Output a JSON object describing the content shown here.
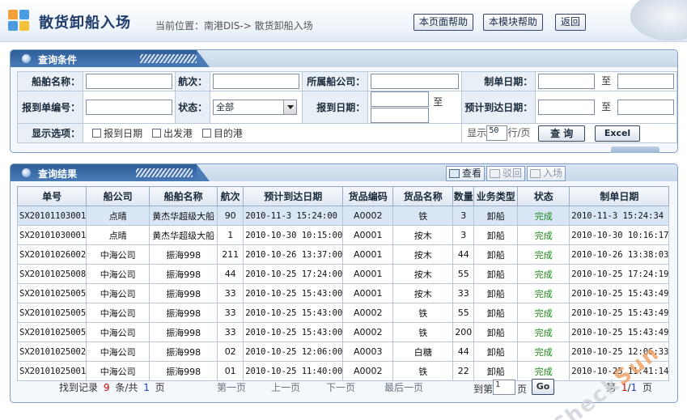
{
  "header": {
    "title": "散货卸船入场",
    "crumb_label": "当前位置：",
    "crumb_path": "南港DIS-> 散货卸船入场",
    "btn_page_help": "本页面帮助",
    "btn_module_help": "本模块帮助",
    "btn_back": "返回"
  },
  "query": {
    "title": "查询条件",
    "ship_name_label": "船舶名称：",
    "voyage_label": "航次：",
    "company_label": "所属船公司：",
    "created_date_label": "制单日期：",
    "to1": "至",
    "report_no_label": "报到单编号：",
    "status_label": "状态：",
    "status_value": "全部",
    "report_date_label": "报到日期：",
    "to2": "至",
    "eta_label": "预计到达日期：",
    "to3": "至",
    "display_label": "显示选项：",
    "opt_report_date": "报到日期",
    "opt_departure": "出发港",
    "opt_destination": "目的港",
    "show_prefix": "显示",
    "page_size": "50",
    "show_suffix": "行/页",
    "search_btn": "查 询",
    "excel_btn": "Excel"
  },
  "results": {
    "title": "查询结果",
    "tool_view": "查看",
    "tool_reject": "驳回",
    "tool_enter": "入场",
    "columns": [
      "单号",
      "船公司",
      "船舶名称",
      "航次",
      "预计到达日期",
      "货品编码",
      "货品名称",
      "数量",
      "业务类型",
      "状态",
      "制单日期"
    ],
    "rows": [
      [
        "SX20101103001",
        "点晴",
        "黄杰华超级大船",
        "90",
        "2010-11-3 15:24:00",
        "A0002",
        "铁",
        "3",
        "卸船",
        "完成",
        "2010-11-3 15:24:34"
      ],
      [
        "SX20101030001",
        "点晴",
        "黄杰华超级大船",
        "1",
        "2010-10-30 10:15:00",
        "A0001",
        "按木",
        "3",
        "卸船",
        "完成",
        "2010-10-30 10:16:17"
      ],
      [
        "SX20101026002",
        "中海公司",
        "振海998",
        "211",
        "2010-10-26 13:37:00",
        "A0001",
        "按木",
        "44",
        "卸船",
        "完成",
        "2010-10-26 13:38:03"
      ],
      [
        "SX20101025008",
        "中海公司",
        "振海998",
        "44",
        "2010-10-25 17:24:00",
        "A0001",
        "按木",
        "55",
        "卸船",
        "完成",
        "2010-10-25 17:24:19"
      ],
      [
        "SX20101025005",
        "中海公司",
        "振海998",
        "33",
        "2010-10-25 15:43:00",
        "A0001",
        "按木",
        "33",
        "卸船",
        "完成",
        "2010-10-25 15:43:49"
      ],
      [
        "SX20101025005",
        "中海公司",
        "振海998",
        "33",
        "2010-10-25 15:43:00",
        "A0002",
        "铁",
        "55",
        "卸船",
        "完成",
        "2010-10-25 15:43:49"
      ],
      [
        "SX20101025005",
        "中海公司",
        "振海998",
        "33",
        "2010-10-25 15:43:00",
        "A0002",
        "铁",
        "200",
        "卸船",
        "完成",
        "2010-10-25 15:43:49"
      ],
      [
        "SX20101025002",
        "中海公司",
        "振海998",
        "02",
        "2010-10-25 12:06:00",
        "A0003",
        "白糖",
        "44",
        "卸船",
        "完成",
        "2010-10-25 12:06:33"
      ],
      [
        "SX20101025001",
        "中海公司",
        "振海998",
        "01",
        "2010-10-25 11:40:00",
        "A0002",
        "铁",
        "22",
        "卸船",
        "完成",
        "2010-10-25 11:41:14"
      ]
    ],
    "pager": {
      "found_prefix": "找到记录",
      "total_records": "9",
      "found_mid": "条/共",
      "total_pages": "1",
      "found_suffix": "页",
      "first": "第一页",
      "prev": "上一页",
      "next": "下一页",
      "last": "最后一页",
      "goto_prefix": "到第",
      "goto_value": "1",
      "goto_suffix": "页",
      "go_btn": "Go",
      "page_prefix": "第",
      "current_page": "1",
      "page_sep": "/",
      "page_total": "1",
      "page_suffix": "页"
    }
  },
  "watermark": {
    "text_a": "Check",
    "text_b": "Sun"
  },
  "colors": {
    "accent": "#2f5f99",
    "status_ok": "#1b8a1b",
    "highlight": "#cc0000"
  }
}
